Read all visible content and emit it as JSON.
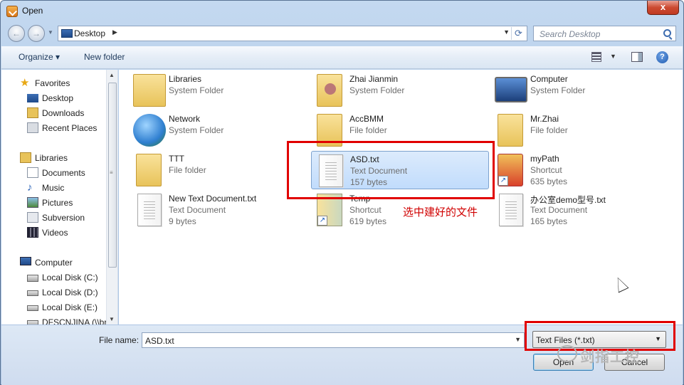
{
  "window": {
    "title": "Open",
    "close": "x"
  },
  "navigation": {
    "back": "←",
    "forward": "→",
    "address": "Desktop",
    "search_placeholder": "Search Desktop"
  },
  "toolbar": {
    "organize": "Organize ▾",
    "new_folder": "New folder"
  },
  "sidebar": {
    "favorites": {
      "label": "Favorites",
      "items": [
        "Desktop",
        "Downloads",
        "Recent Places"
      ]
    },
    "libraries": {
      "label": "Libraries",
      "items": [
        "Documents",
        "Music",
        "Pictures",
        "Subversion",
        "Videos"
      ]
    },
    "computer": {
      "label": "Computer",
      "items": [
        "Local Disk (C:)",
        "Local Disk (D:)",
        "Local Disk (E:)",
        "DFSCNJINA (\\\\br"
      ]
    }
  },
  "files": [
    {
      "name": "Libraries",
      "line2": "System Folder",
      "line3": "",
      "icon": "libraries-icon"
    },
    {
      "name": "Zhai Jianmin",
      "line2": "System Folder",
      "line3": "",
      "icon": "user-folder-icon"
    },
    {
      "name": "Computer",
      "line2": "System Folder",
      "line3": "",
      "icon": "computer-icon"
    },
    {
      "name": "Network",
      "line2": "System Folder",
      "line3": "",
      "icon": "network-icon"
    },
    {
      "name": "AccBMM",
      "line2": "File folder",
      "line3": "",
      "icon": "folder-icon"
    },
    {
      "name": "Mr.Zhai",
      "line2": "File folder",
      "line3": "",
      "icon": "folder-icon"
    },
    {
      "name": "TTT",
      "line2": "File folder",
      "line3": "",
      "icon": "folder-icon"
    },
    {
      "name": "ASD.txt",
      "line2": "Text Document",
      "line3": "157 bytes",
      "icon": "text-document-icon"
    },
    {
      "name": "myPath",
      "line2": "Shortcut",
      "line3": "635 bytes",
      "icon": "shortcut-icon"
    },
    {
      "name": "New Text Document.txt",
      "line2": "Text Document",
      "line3": "9 bytes",
      "icon": "text-document-icon"
    },
    {
      "name": "Temp",
      "line2": "Shortcut",
      "line3": "619 bytes",
      "icon": "shortcut-icon"
    },
    {
      "name": "办公室demo型号.txt",
      "line2": "Text Document",
      "line3": "165 bytes",
      "icon": "text-document-icon"
    }
  ],
  "annotation": "选中建好的文件",
  "footer": {
    "file_name_label": "File name:",
    "file_name_value": "ASD.txt",
    "file_type": "Text Files (*.txt)",
    "open": "Open",
    "cancel": "Cancel"
  },
  "watermark": "剑指工控",
  "colors": {
    "annotation_red": "#e10000",
    "selection": "#c1dcfc"
  }
}
